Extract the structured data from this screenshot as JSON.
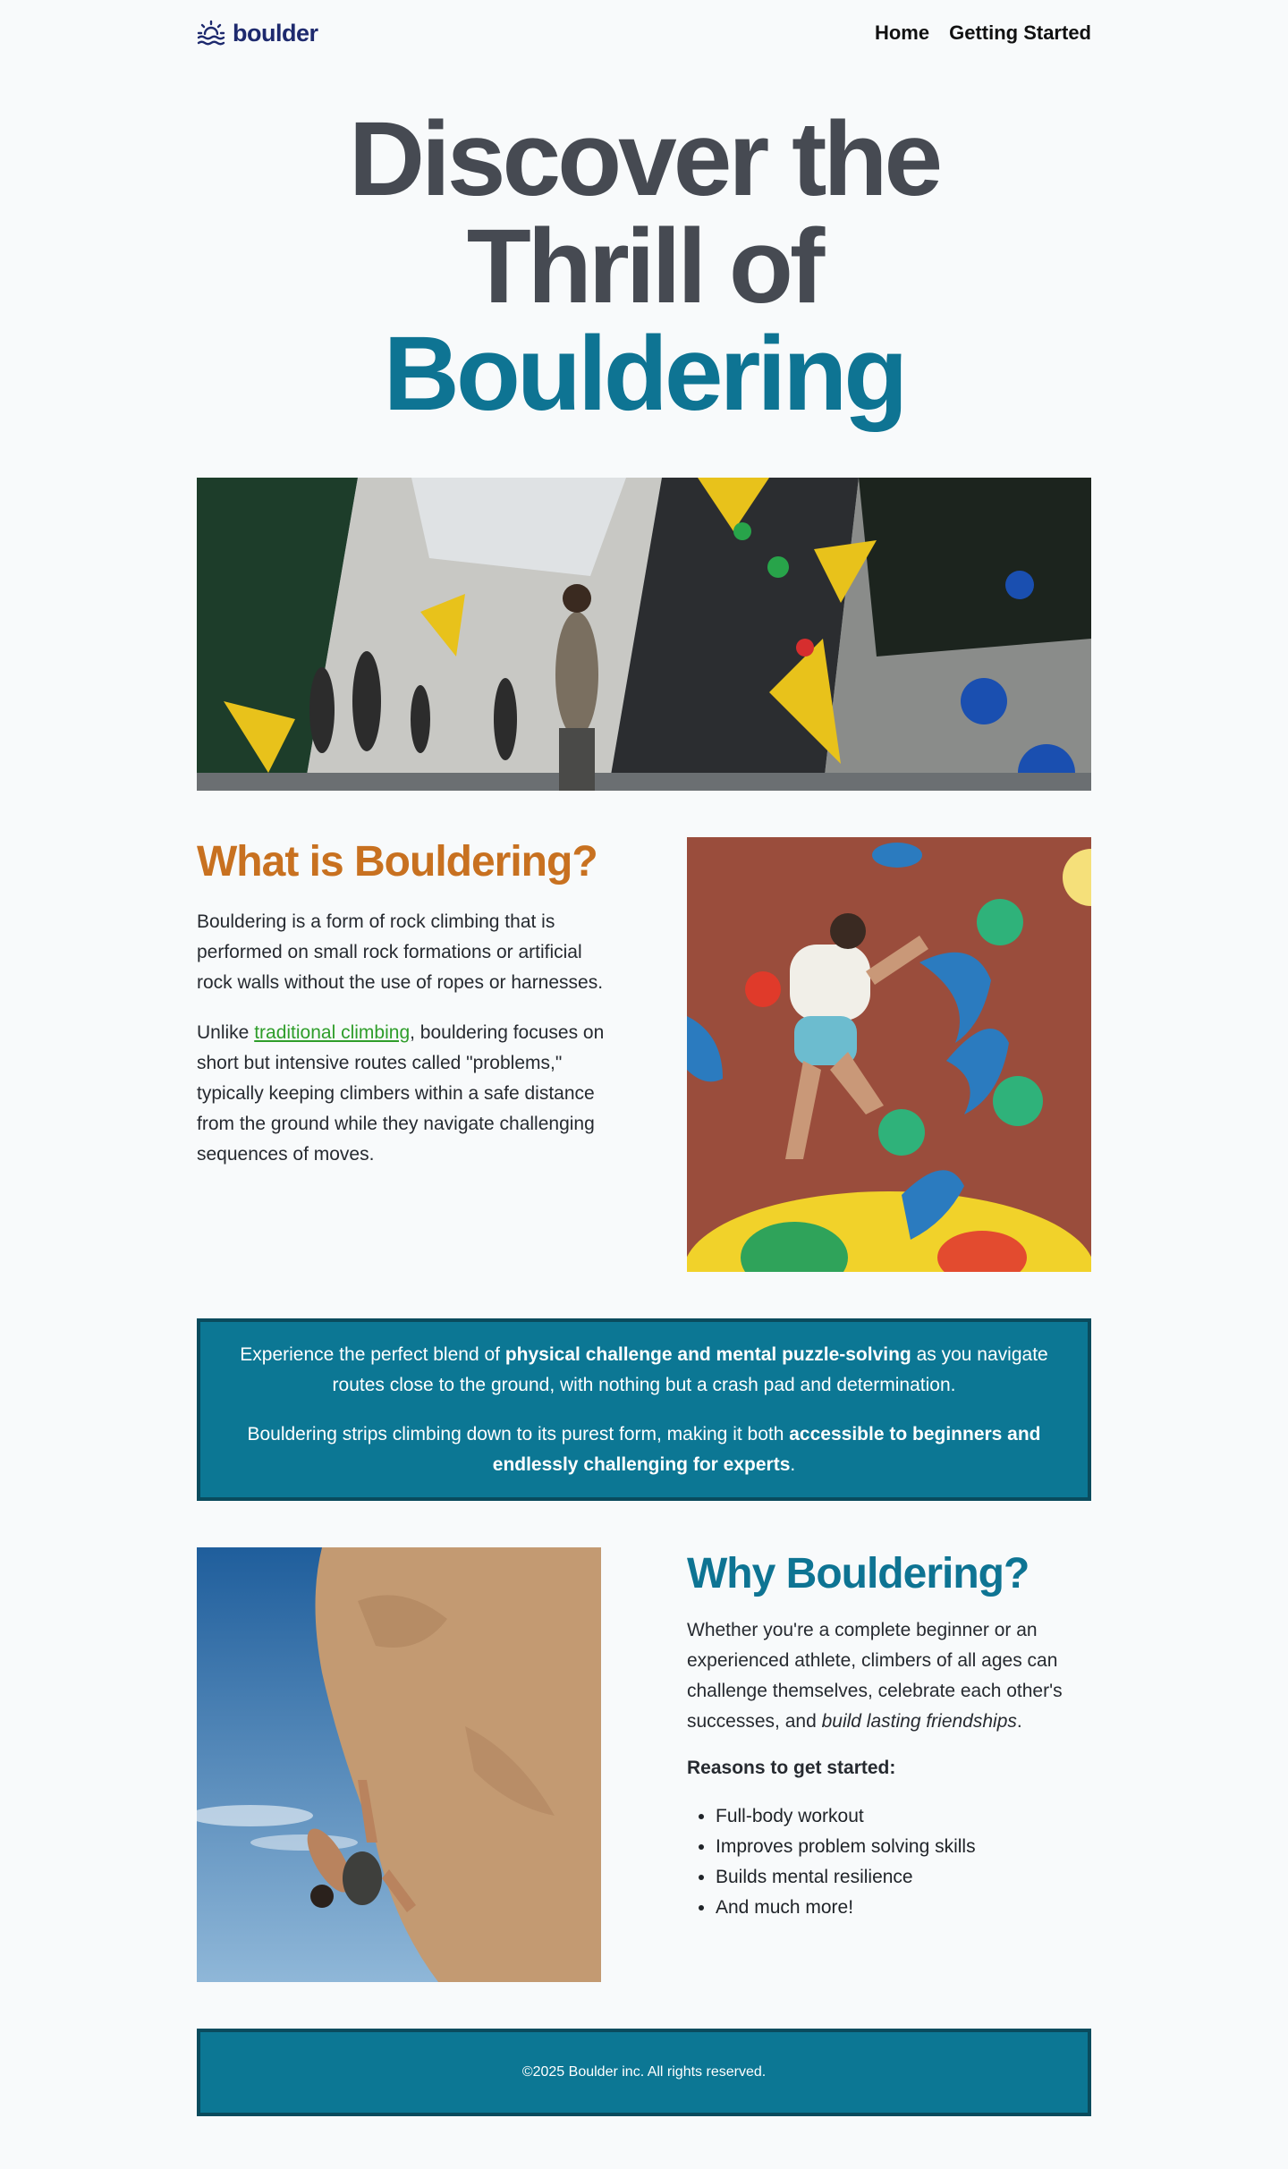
{
  "header": {
    "logo_text": "boulder",
    "nav": [
      "Home",
      "Getting Started"
    ]
  },
  "hero": {
    "line1": "Discover the",
    "line2": "Thrill of",
    "accent": "Bouldering"
  },
  "what": {
    "title": "What is Bouldering?",
    "p1": "Bouldering is a form of rock climbing that is performed on small rock formations or artificial rock walls without the use of ropes or harnesses.",
    "p2_pre": "Unlike ",
    "p2_link": "traditional climbing",
    "p2_post": ", bouldering focuses on short but intensive routes called \"problems,\" typically keeping climbers within a safe distance from the ground while they navigate challenging sequences of moves."
  },
  "callout": {
    "p1_pre": "Experience the perfect blend of ",
    "p1_bold": "physical challenge and mental puzzle-solving",
    "p1_post": " as you navigate routes close to the ground, with nothing but a crash pad and determination.",
    "p2_pre": "Bouldering strips climbing down to its purest form, making it both ",
    "p2_bold": "accessible to beginners and endlessly challenging for experts",
    "p2_post": "."
  },
  "why": {
    "title": "Why Bouldering?",
    "p1_pre": "Whether you're a complete beginner or an experienced athlete, climbers of all ages can challenge themselves, celebrate each other's successes, and ",
    "p1_em": "build lasting friendships",
    "p1_post": ".",
    "reasons_label": "Reasons to get started:",
    "reasons": [
      "Full-body workout",
      "Improves problem solving skills",
      "Builds mental resilience",
      "And much more!"
    ]
  },
  "footer": {
    "text": "©2025 Boulder inc. All rights reserved."
  },
  "colors": {
    "accent_teal": "#0e7493",
    "accent_orange": "#c87120",
    "link_green": "#2e9d2a",
    "logo_navy": "#1e2a6e"
  }
}
